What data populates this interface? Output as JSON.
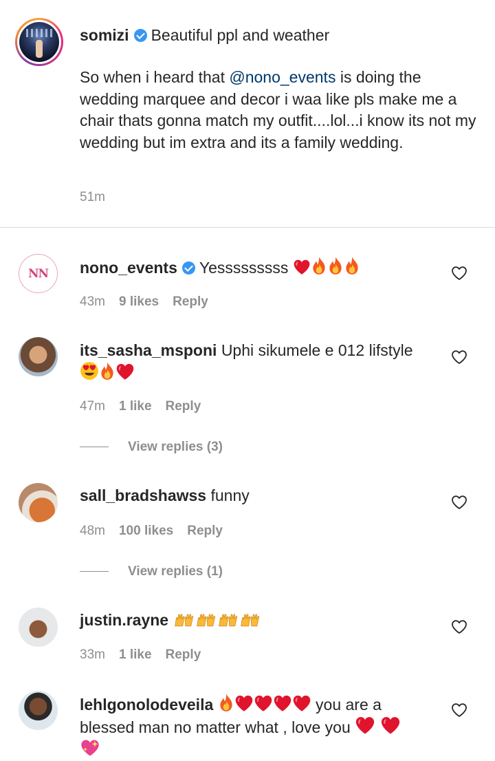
{
  "caption": {
    "username": "somizi",
    "first_line": "Beautiful ppl and weather",
    "body_before_mention": "So when i heard that ",
    "mention": "@nono_events",
    "body_after_mention": " is doing the wedding marquee and decor i waa like pls make me a chair thats gonna match my outfit....lol...i know its not my wedding but im extra and its a family wedding.",
    "time": "51m"
  },
  "comments": [
    {
      "username": "nono_events",
      "verified": true,
      "text": "Yesssssssss",
      "emojis": [
        "red-heart",
        "fire",
        "fire",
        "fire"
      ],
      "time": "43m",
      "likes": "9 likes",
      "reply_label": "Reply"
    },
    {
      "username": "its_sasha_msponi",
      "text": "Uphi sikumele e 012 lifstyle",
      "emojis": [
        "heart-eyes",
        "fire",
        "red-heart"
      ],
      "time": "47m",
      "likes": "1 like",
      "reply_label": "Reply",
      "view_replies": "View replies (3)"
    },
    {
      "username": "sall_bradshawss",
      "text": "funny",
      "time": "48m",
      "likes": "100 likes",
      "reply_label": "Reply",
      "view_replies": "View replies (1)"
    },
    {
      "username": "justin.rayne",
      "text": "",
      "emojis": [
        "raising-hands",
        "raising-hands",
        "raising-hands",
        "raising-hands",
        "raising-hands",
        "raising-hands",
        "raising-hands",
        "raising-hands"
      ],
      "time": "33m",
      "likes": "1 like",
      "reply_label": "Reply"
    },
    {
      "username": "lehlgonolodeveila",
      "text_part1": "you are a blessed man no matter what , love you",
      "emojis": [
        "fire",
        "red-heart",
        "red-heart",
        "red-heart",
        "red-heart",
        "red-heart",
        "red-heart",
        "sparkling-heart"
      ]
    }
  ],
  "colors": {
    "text": "#262626",
    "muted": "#8e8e8e",
    "mention": "#00376b",
    "verified": "#3897f0",
    "divider": "#dbdbdb"
  },
  "icons": [
    "verified-badge-icon",
    "heart-outline-icon",
    "red-heart-emoji",
    "fire-emoji",
    "heart-eyes-emoji",
    "raising-hands-emoji",
    "sparkling-heart-emoji"
  ]
}
